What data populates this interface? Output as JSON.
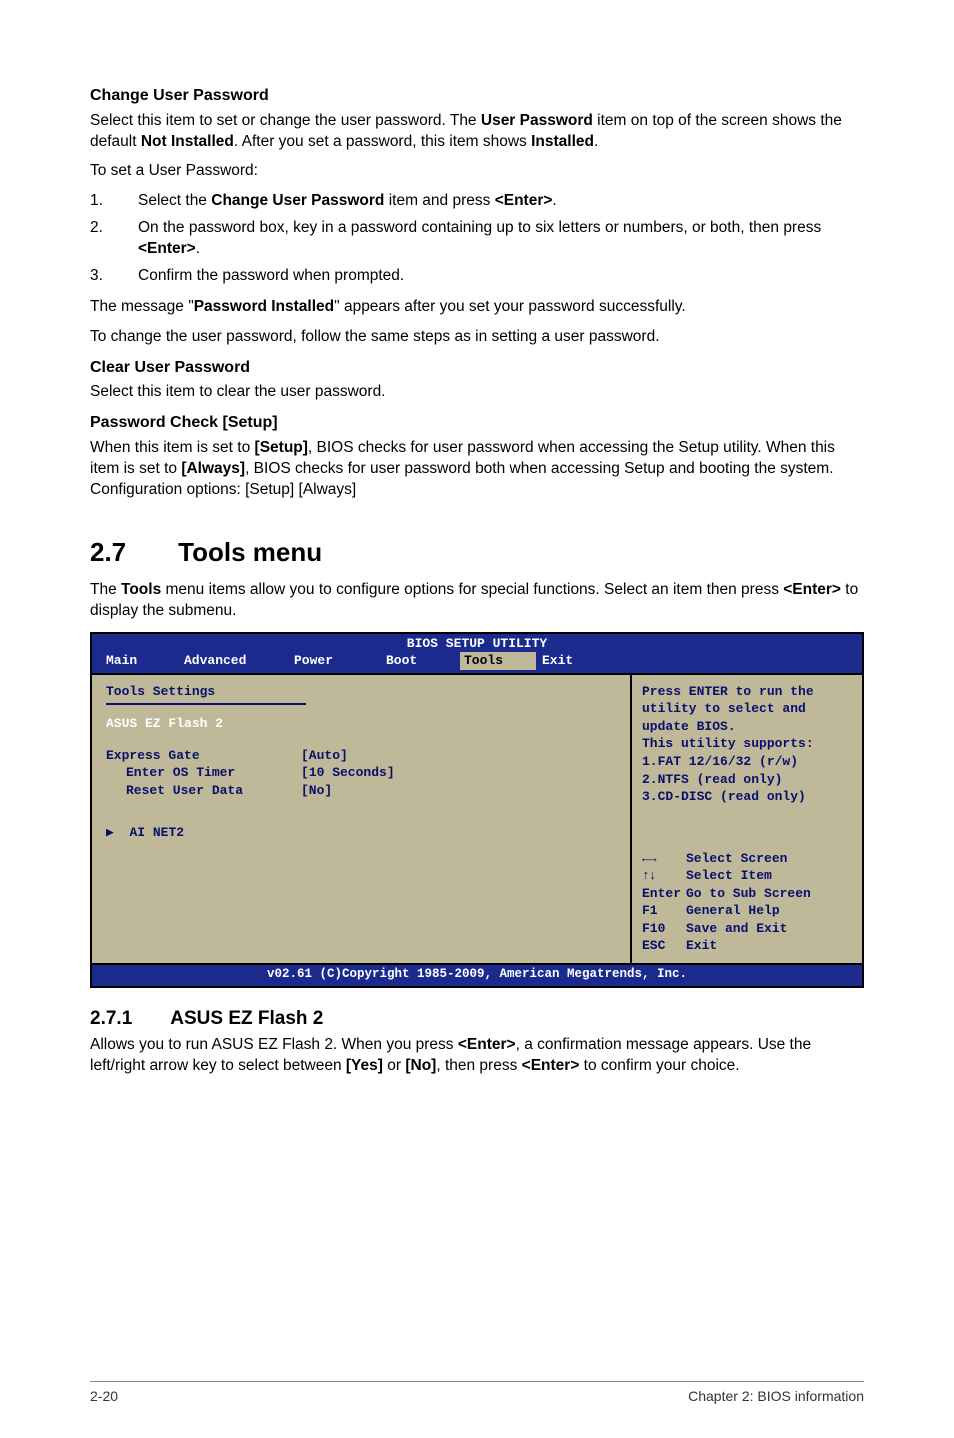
{
  "s1": {
    "h": "Change User Password",
    "p1a": "Select this item to set or change the user password. The ",
    "p1b": "User Password",
    "p1c": " item on top of the screen shows the default ",
    "p1d": "Not Installed",
    "p1e": ". After you set a password, this item shows ",
    "p1f": "Installed",
    "p1g": ".",
    "p2": "To set a User Password:",
    "li1n": "1.",
    "li1a": "Select the ",
    "li1b": "Change User Password",
    "li1c": " item and press ",
    "li1d": "<Enter>",
    "li1e": ".",
    "li2n": "2.",
    "li2": "On the password box, key in a password containing up to six letters or numbers, or both, then press ",
    "li2b": "<Enter>",
    "li2c": ".",
    "li3n": "3.",
    "li3": "Confirm the password when prompted.",
    "p3a": "The message \"",
    "p3b": "Password Installed",
    "p3c": "\" appears after you set your password successfully.",
    "p4": "To change the user password, follow the same steps as in setting a user password."
  },
  "s2": {
    "h": "Clear User Password",
    "p": "Select this item to clear the user password."
  },
  "s3": {
    "h": "Password Check [Setup]",
    "p1": "When this item is set to ",
    "p1b": "[Setup]",
    "p1c": ", BIOS checks for user password when accessing the Setup utility. When this item is set to ",
    "p1d": "[Always]",
    "p1e": ", BIOS checks for user password both when accessing Setup and booting the system. Configuration options: [Setup] [Always]"
  },
  "s4": {
    "h": "2.7  Tools menu",
    "p1a": "The ",
    "p1b": "Tools",
    "p1c": " menu items allow you to configure options for special functions. Select an item then press ",
    "p1d": "<Enter>",
    "p1e": " to display the submenu."
  },
  "bios": {
    "title": "BIOS SETUP UTILITY",
    "tabs": {
      "main": "Main",
      "advanced": "Advanced",
      "power": "Power",
      "boot": "Boot",
      "tools": "Tools",
      "exit": "Exit"
    },
    "left": {
      "settings": "Tools Settings",
      "ezflash": "ASUS EZ Flash 2",
      "expressgate": "Express Gate",
      "expressgate_val": "[Auto]",
      "enteros": "Enter OS Timer",
      "enteros_val": "[10 Seconds]",
      "resetuser": "Reset User Data",
      "resetuser_val": "[No]",
      "ainet": "AI NET2"
    },
    "right": {
      "l1": "Press ENTER to run the utility to select and update BIOS.",
      "l2": "This utility supports:",
      "l3": "1.FAT 12/16/32 (r/w)",
      "l4": "2.NTFS (read only)",
      "l5": "3.CD-DISC (read only)",
      "k1": "Select Screen",
      "k2": "Select Item",
      "k3l": "Enter",
      "k3": "Go to Sub Screen",
      "k4l": "F1",
      "k4": "General Help",
      "k5l": "F10",
      "k5": "Save and Exit",
      "k6l": "ESC",
      "k6": "Exit"
    },
    "footer": "v02.61 (C)Copyright 1985-2009, American Megatrends, Inc."
  },
  "s5": {
    "h": "2.7.1  ASUS EZ Flash 2",
    "p1": "Allows you to run ASUS EZ Flash 2. When you press ",
    "p1b": "<Enter>",
    "p1c": ", a confirmation message appears. Use the left/right arrow key to select between ",
    "p1d": "[Yes]",
    "p1e": " or ",
    "p1f": "[No]",
    "p1g": ", then press ",
    "p1h": "<Enter>",
    "p1i": " to confirm your choice."
  },
  "footer": {
    "left": "2-20",
    "right": "Chapter 2: BIOS information"
  }
}
